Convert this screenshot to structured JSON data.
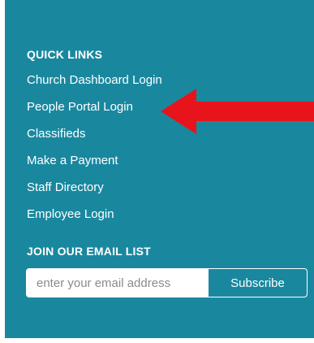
{
  "quick_links": {
    "title": "QUICK LINKS",
    "items": [
      {
        "label": "Church Dashboard Login"
      },
      {
        "label": "People Portal Login"
      },
      {
        "label": "Classifieds"
      },
      {
        "label": "Make a Payment"
      },
      {
        "label": "Staff Directory"
      },
      {
        "label": "Employee Login"
      }
    ]
  },
  "email_list": {
    "title": "JOIN OUR EMAIL LIST",
    "input_placeholder": "enter your email address",
    "input_value": "",
    "subscribe_label": "Subscribe"
  },
  "annotation": {
    "arrow_icon": "red-left-arrow-icon",
    "arrow_color": "#e8141c"
  },
  "colors": {
    "panel_background": "#19889f",
    "text": "#ffffff"
  }
}
